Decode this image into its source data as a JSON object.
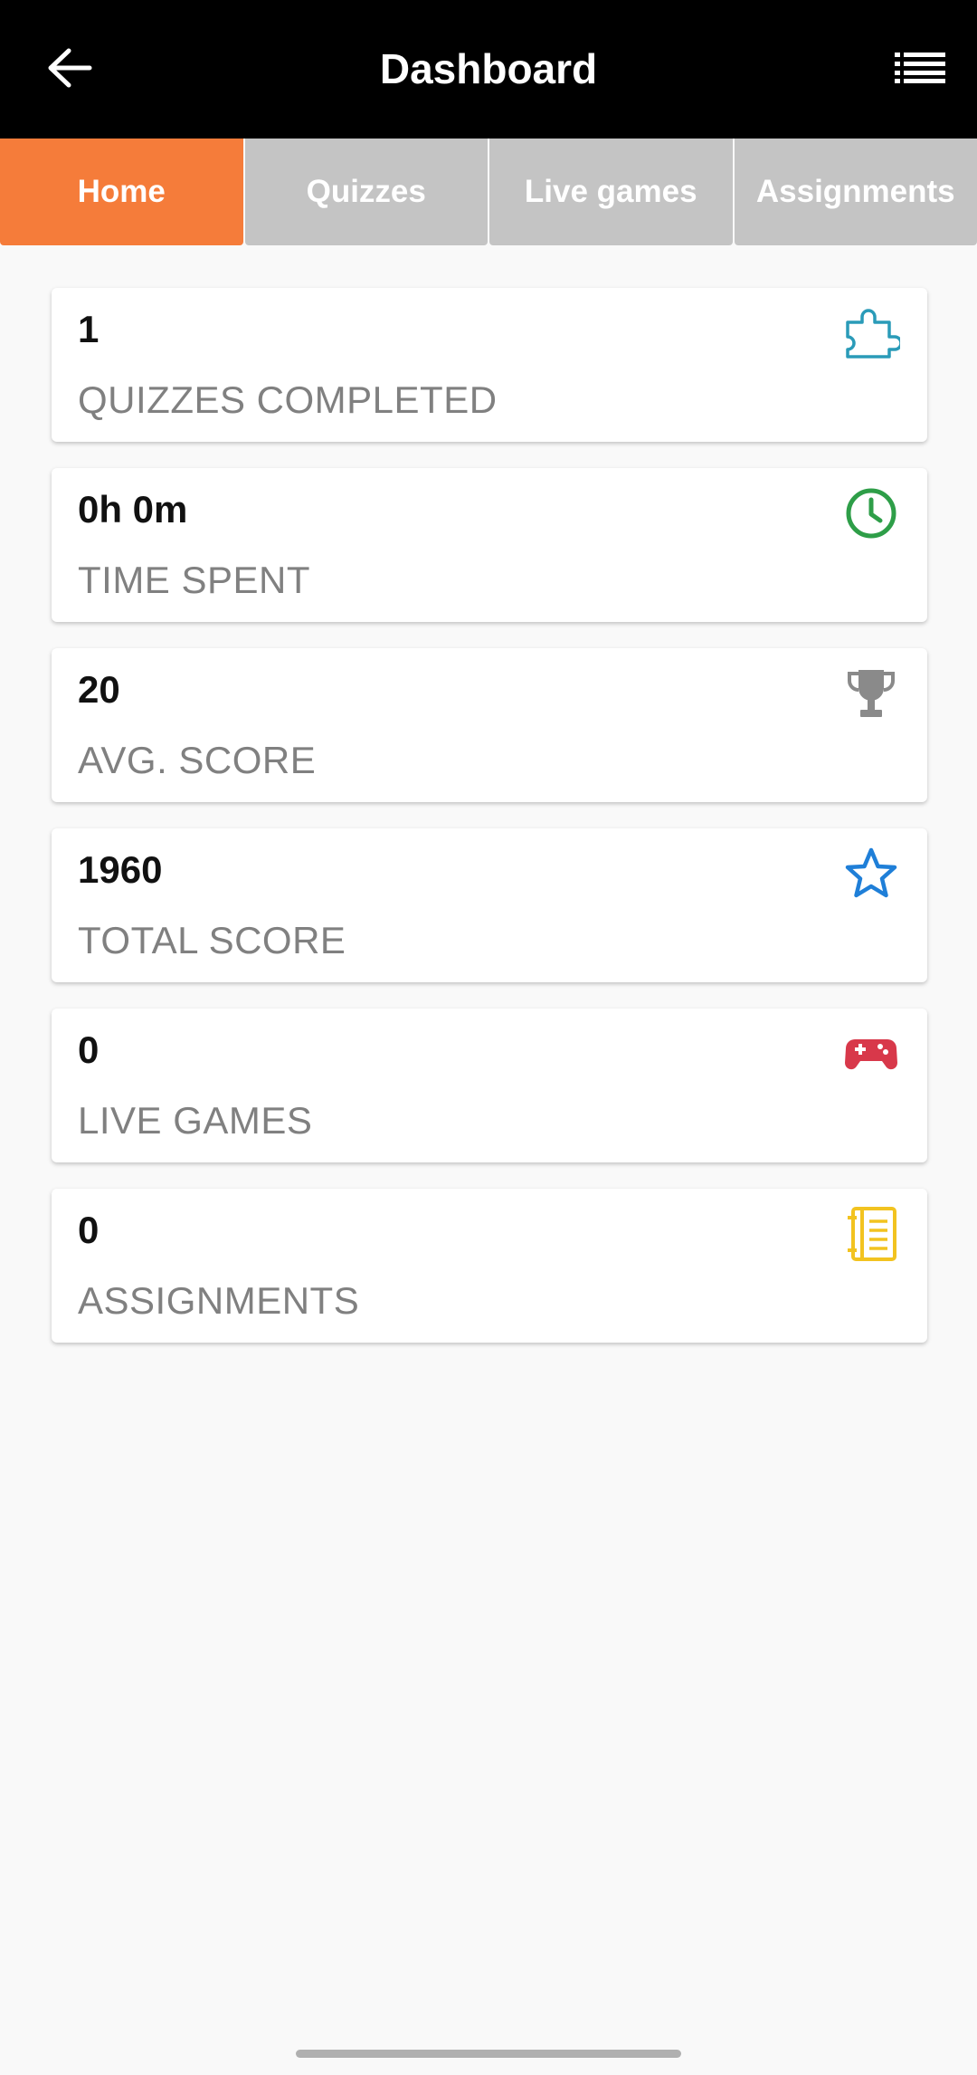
{
  "header": {
    "title": "Dashboard",
    "back_icon": "arrow-left-icon",
    "menu_icon": "list-icon"
  },
  "tabs": [
    {
      "label": "Home",
      "active": true
    },
    {
      "label": "Quizzes",
      "active": false
    },
    {
      "label": "Live games",
      "active": false
    },
    {
      "label": "Assignments",
      "active": false
    }
  ],
  "stats": [
    {
      "value": "1",
      "label": "QUIZZES COMPLETED",
      "icon": "puzzle-icon",
      "color": "#2a9bb8"
    },
    {
      "value": "0h 0m",
      "label": "TIME SPENT",
      "icon": "clock-icon",
      "color": "#2e9e48"
    },
    {
      "value": "20",
      "label": "AVG. SCORE",
      "icon": "trophy-icon",
      "color": "#8a8a8a"
    },
    {
      "value": "1960",
      "label": "TOTAL SCORE",
      "icon": "star-icon",
      "color": "#1f7fd8"
    },
    {
      "value": "0",
      "label": "LIVE GAMES",
      "icon": "gamepad-icon",
      "color": "#d8384a"
    },
    {
      "value": "0",
      "label": "ASSIGNMENTS",
      "icon": "notebook-icon",
      "color": "#f2c320"
    }
  ],
  "theme": {
    "accent": "#f57c3a",
    "tab_inactive": "#c4c4c4",
    "header_bg": "#000000"
  }
}
